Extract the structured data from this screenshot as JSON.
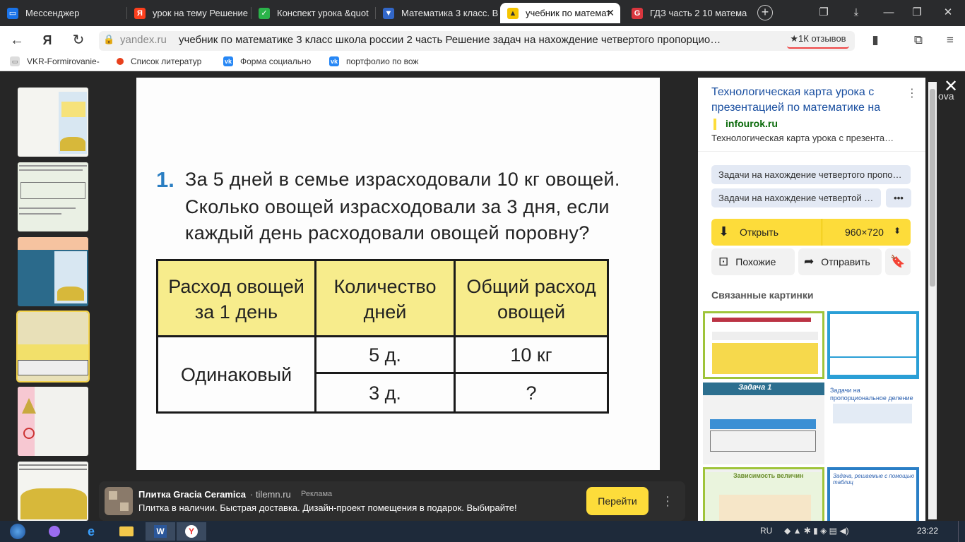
{
  "tabs": [
    {
      "label": "Мессенджер",
      "icon": "messenger-icon",
      "color": "#1a73e8"
    },
    {
      "label": "урок на тему Решение",
      "icon": "yandex-icon",
      "color": "#fc3f1d"
    },
    {
      "label": "Конспект урока &quot",
      "icon": "check-icon",
      "color": "#2bb34a"
    },
    {
      "label": "Математика 3 класс. В",
      "icon": "bookmark-icon",
      "color": "#3267c8"
    },
    {
      "label": "учебник по математ",
      "icon": "image-icon",
      "color": "#f5c400"
    },
    {
      "label": "ГДЗ часть 2 10 матема",
      "icon": "gdz-icon",
      "color": "#d9363e"
    }
  ],
  "address": {
    "domain": "yandex.ru",
    "title": "учебник по математике 3 класс школа россии 2 часть Решение задач на нахождение четвертого пропорцио…",
    "reviews": "★1К отзывов"
  },
  "bookmarks": [
    {
      "label": "VKR-Formirovanie-",
      "icon": "doc-icon"
    },
    {
      "label": "Список литератур",
      "icon": "circle-icon"
    },
    {
      "label": "Форма социально",
      "icon": "vk-icon"
    },
    {
      "label": "портфолио по вож",
      "icon": "vk-icon"
    }
  ],
  "problem": {
    "number": "1.",
    "line1": "За 5 дней в семье израсходовали 10 кг овощей.",
    "line2": "Сколько овощей израсходовали за 3 дня, если",
    "line3": "каждый день расходовали овощей поровну?",
    "table": {
      "headers": [
        "Расход овощей за 1 день",
        "Количество дней",
        "Общий расход овощей"
      ],
      "merged": "Одинаковый",
      "rows": [
        [
          "5 д.",
          "10 кг"
        ],
        [
          "3 д.",
          "?"
        ]
      ]
    }
  },
  "panel": {
    "title": "Технологическая карта урока с презентацией по математике на",
    "source": "infourok.ru",
    "description": "Технологическая карта урока с презента…",
    "chips": [
      "Задачи на нахождение четвертого пропо…",
      "Задачи на нахождение четвертой …"
    ],
    "more": "•••",
    "open_label": "Открыть",
    "size": "960×720",
    "similar": "Похожие",
    "share": "Отправить",
    "related": "Связанные картинки",
    "related_texts": {
      "r3_title": "Задача 1",
      "r4_title": "Задачи на пропорциональное деление",
      "r5_title": "Зависимость величин",
      "r6_title": "Задача, решаемые с помощью таблиц"
    }
  },
  "ad": {
    "title": "Плитка Gracia Ceramica",
    "domain": "· tilemn.ru",
    "tag": "Реклама",
    "text": "Плитка в наличии. Быстрая доставка. Дизайн-проект помещения в подарок. Выбирайте!",
    "button": "Перейти"
  },
  "right_edge_text": "ova",
  "taskbar": {
    "lang": "RU",
    "time": "23:22"
  }
}
